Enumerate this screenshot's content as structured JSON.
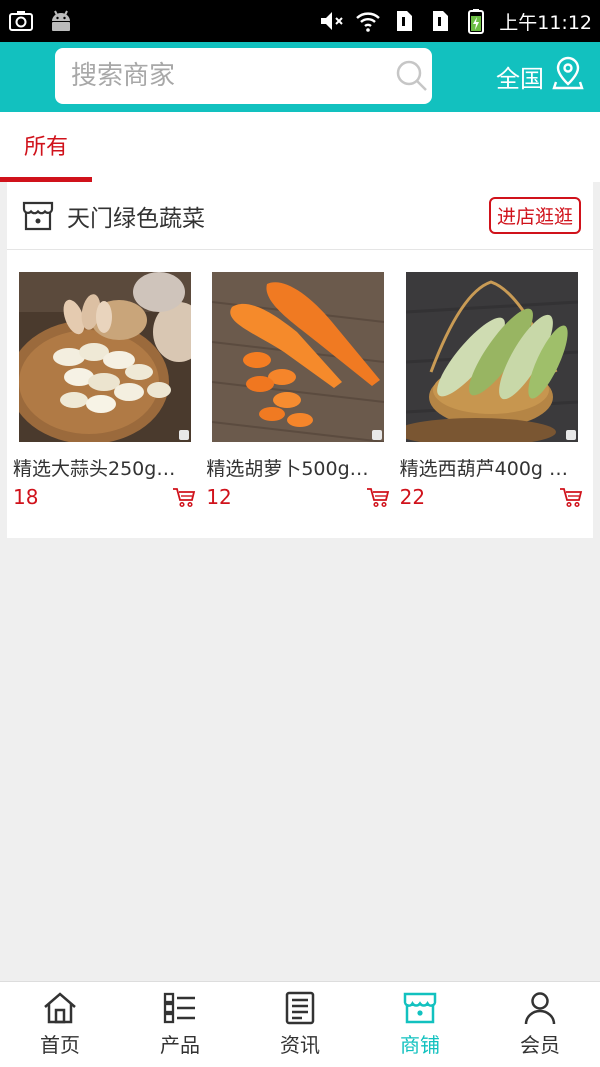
{
  "status_bar": {
    "time": "上午11:12"
  },
  "header": {
    "search_placeholder": "搜索商家",
    "region_label": "全国"
  },
  "tabs": [
    {
      "label": "所有",
      "active": true
    }
  ],
  "store": {
    "name": "天门绿色蔬菜",
    "visit_label": "进店逛逛",
    "products": [
      {
        "name": "精选大蒜头250g…",
        "price": "18",
        "image": "garlic"
      },
      {
        "name": "精选胡萝卜500g…",
        "price": "12",
        "image": "carrot"
      },
      {
        "name": "精选西葫芦400g …",
        "price": "22",
        "image": "zucchini"
      }
    ]
  },
  "bottom_nav": [
    {
      "label": "首页",
      "icon": "home-icon"
    },
    {
      "label": "产品",
      "icon": "list-icon"
    },
    {
      "label": "资讯",
      "icon": "news-icon"
    },
    {
      "label": "商铺",
      "icon": "store-icon",
      "active": true
    },
    {
      "label": "会员",
      "icon": "user-icon"
    }
  ],
  "colors": {
    "accent": "#12c1bf",
    "highlight": "#d0121b"
  }
}
